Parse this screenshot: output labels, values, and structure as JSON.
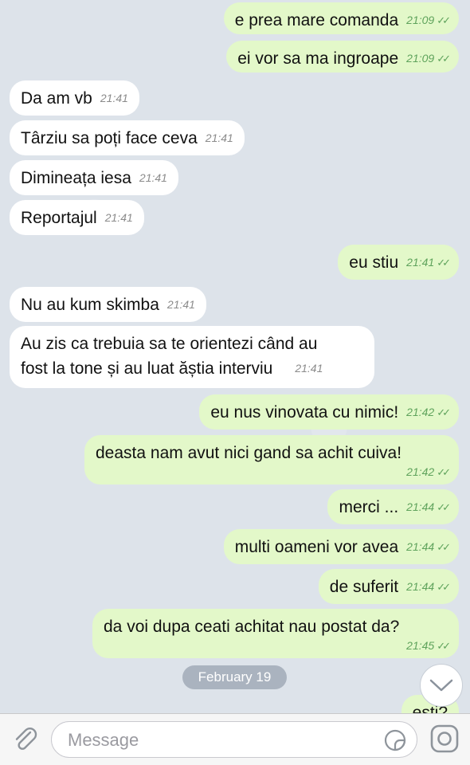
{
  "messages": [
    {
      "dir": "out",
      "text": "e prea mare comanda",
      "time": "21:09",
      "read": true
    },
    {
      "dir": "out",
      "text": "ei vor sa ma ingroape",
      "time": "21:09",
      "read": true
    },
    {
      "dir": "in",
      "text": "Da am vb",
      "time": "21:41"
    },
    {
      "dir": "in",
      "text": "Târziu sa poți face ceva",
      "time": "21:41"
    },
    {
      "dir": "in",
      "text": "Dimineața iesa",
      "time": "21:41"
    },
    {
      "dir": "in",
      "text": "Reportajul",
      "time": "21:41"
    },
    {
      "dir": "out",
      "text": "eu stiu",
      "time": "21:41",
      "read": true
    },
    {
      "dir": "in",
      "text": "Nu au kum skimba",
      "time": "21:41"
    },
    {
      "dir": "in",
      "text": "Au zis ca trebuia sa te orientezi când au",
      "text2": "fost la tone și au luat ăștia interviu",
      "time": "21:41"
    },
    {
      "dir": "out",
      "text": "eu nus vinovata cu nimic!",
      "time": "21:42",
      "read": true
    },
    {
      "dir": "out",
      "text": "deasta nam avut nici gand sa achit cuiva!",
      "time": "21:42",
      "read": true
    },
    {
      "dir": "out",
      "text": "merci ...",
      "time": "21:44",
      "read": true
    },
    {
      "dir": "out",
      "text": "multi oameni vor avea",
      "time": "21:44",
      "read": true
    },
    {
      "dir": "out",
      "text": "de suferit",
      "time": "21:44",
      "read": true
    },
    {
      "dir": "out",
      "text": "da voi dupa ceati achitat nau postat da?",
      "time": "21:45",
      "read": true
    },
    {
      "dir": "out",
      "text": "esti?",
      "time": ""
    }
  ],
  "date_separator": "February 19",
  "composer": {
    "placeholder": "Message"
  },
  "icons": {
    "attach": "paperclip-icon",
    "sticker": "sticker-icon",
    "camera": "camera-icon",
    "scroll": "chevron-down-icon"
  },
  "colors": {
    "outgoing": "#e3f8c9",
    "incoming": "#ffffff",
    "check": "#5fa35c"
  }
}
